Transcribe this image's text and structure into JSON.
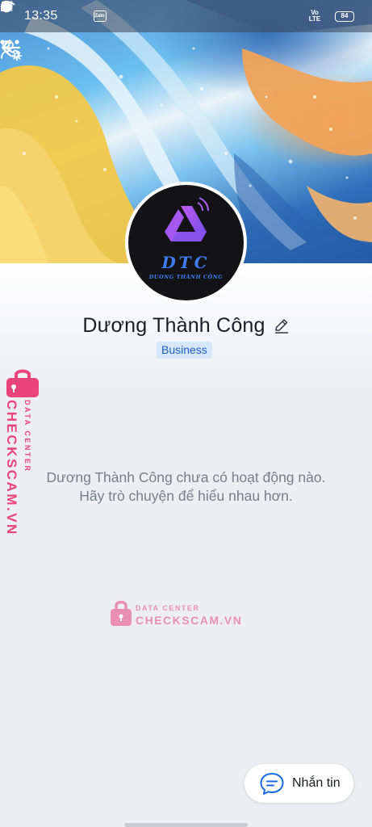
{
  "status_bar": {
    "time": "13:35",
    "app_icons": [
      "snapchat-icon",
      "messenger-icon",
      "zalo-icon"
    ],
    "zalo_label": "Zalo",
    "volte_label": "Vo LTE",
    "battery": "84"
  },
  "topbar": {
    "back": "back-arrow-icon",
    "actions": [
      "phone-icon",
      "profile-settings-icon",
      "more-icon"
    ]
  },
  "profile": {
    "avatar_text": "DTC",
    "avatar_subtext": "DUONG THÀNH CÔNG",
    "name": "Dương Thành Công",
    "badge": "Business"
  },
  "feed": {
    "empty_text": "Dương Thành Công chưa có hoạt động nào. Hãy trò chuyện để hiểu nhau hơn."
  },
  "watermark": {
    "brand": "CHECKSCAM.VN",
    "tagline": "DATA CENTER"
  },
  "message_button": {
    "label": "Nhắn tin"
  },
  "colors": {
    "accent": "#1d5fbf",
    "badge_bg": "#d6e6fb",
    "watermark": "#e8437a"
  }
}
